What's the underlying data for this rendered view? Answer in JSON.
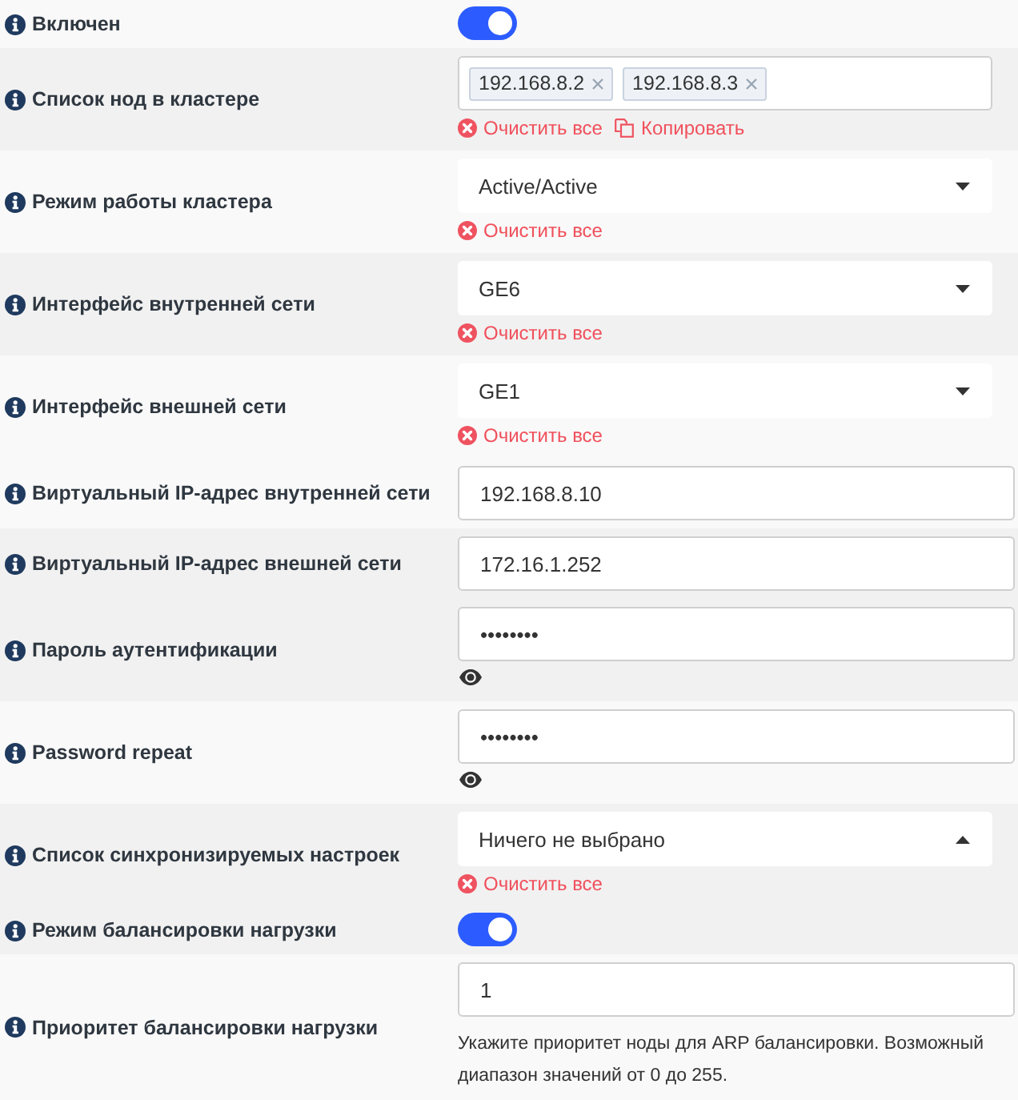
{
  "rows": [
    {
      "label": "Включен",
      "control": {
        "kind": "toggle",
        "on": true
      }
    },
    {
      "label": "Список нод в кластере",
      "control": {
        "kind": "tags",
        "tags": [
          "192.168.8.2",
          "192.168.8.3"
        ]
      },
      "actions": [
        {
          "kind": "clear",
          "label": "Очистить все"
        },
        {
          "kind": "copy",
          "label": "Копировать"
        }
      ]
    },
    {
      "label": "Режим работы кластера",
      "control": {
        "kind": "select",
        "value": "Active/Active",
        "expanded": false
      },
      "actions": [
        {
          "kind": "clear",
          "label": "Очистить все"
        }
      ]
    },
    {
      "label": "Интерфейс внутренней сети",
      "control": {
        "kind": "select",
        "value": "GE6",
        "expanded": false
      },
      "actions": [
        {
          "kind": "clear",
          "label": "Очистить все"
        }
      ]
    },
    {
      "label": "Интерфейс внешней сети",
      "control": {
        "kind": "select",
        "value": "GE1",
        "expanded": false
      },
      "actions": [
        {
          "kind": "clear",
          "label": "Очистить все"
        }
      ]
    },
    {
      "label": "Виртуальный IP-адрес внутренней сети",
      "control": {
        "kind": "text",
        "value": "192.168.8.10"
      }
    },
    {
      "label": "Виртуальный IP-адрес внешней сети",
      "control": {
        "kind": "text",
        "value": "172.16.1.252"
      }
    },
    {
      "label": "Пароль аутентификации",
      "control": {
        "kind": "password",
        "value": "••••••••"
      }
    },
    {
      "label": "Password repeat",
      "control": {
        "kind": "password",
        "value": "••••••••"
      }
    },
    {
      "label": "Список синхронизируемых настроек",
      "control": {
        "kind": "select",
        "value": "Ничего не выбрано",
        "expanded": true
      },
      "actions": [
        {
          "kind": "clear",
          "label": "Очистить все"
        }
      ]
    },
    {
      "label": "Режим балансировки нагрузки",
      "control": {
        "kind": "toggle",
        "on": true
      }
    },
    {
      "label": "Приоритет балансировки нагрузки",
      "control": {
        "kind": "text",
        "value": "1"
      },
      "help": "Укажите приоритет ноды для ARP балансировки. Возможный диапазон значений от 0 до 255."
    }
  ]
}
